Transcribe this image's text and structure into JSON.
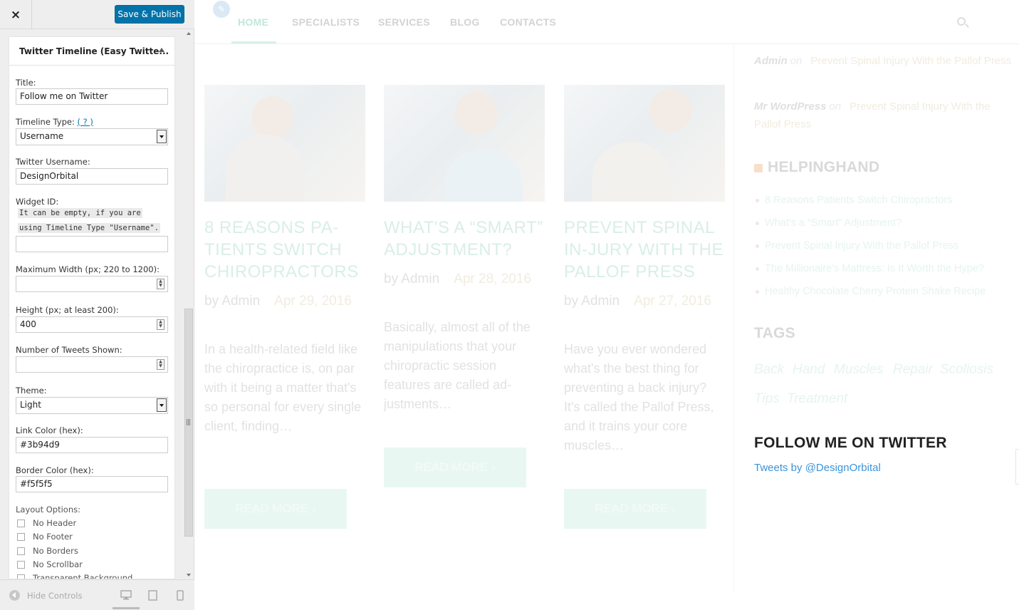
{
  "sidebar": {
    "close_label": "×",
    "save_label": "Save & Publish",
    "panel_title": "Twitter Timeline (Easy Twitte...",
    "fields": {
      "title_label": "Title:",
      "title_value": "Follow me on Twitter",
      "timeline_type_label": "Timeline Type:",
      "timeline_type_help": "( ? )",
      "timeline_type_value": "Username",
      "username_label": "Twitter Username:",
      "username_value": "DesignOrbital",
      "widget_id_label": "Widget ID:",
      "widget_id_desc_1": "It can be empty, if you are",
      "widget_id_desc_2": "using Timeline Type \"Username\".",
      "widget_id_value": "",
      "max_width_label": "Maximum Width (px; 220 to 1200):",
      "max_width_value": "",
      "height_label": "Height (px; at least 200):",
      "height_value": "400",
      "tweets_label": "Number of Tweets Shown:",
      "tweets_value": "",
      "theme_label": "Theme:",
      "theme_value": "Light",
      "link_color_label": "Link Color (hex):",
      "link_color_value": "#3b94d9",
      "border_color_label": "Border Color (hex):",
      "border_color_value": "#f5f5f5",
      "layout_label": "Layout Options:"
    },
    "layout_options": [
      "No Header",
      "No Footer",
      "No Borders",
      "No Scrollbar",
      "Transparent Background"
    ],
    "footer": {
      "hide_controls": "Hide Controls"
    }
  },
  "site": {
    "nav": [
      "HOME",
      "SPECIALISTS",
      "SERVICES",
      "BLOG",
      "CONTACTS"
    ],
    "posts": [
      {
        "title": "8 REASONS PA-TIENTS SWITCH CHIROPRACTORS",
        "author": "by Admin",
        "date": "Apr 29, 2016",
        "excerpt": "In a health-related field like the chiropractice is, on par with it being a matter that's so personal for every single client, finding…",
        "button": "READ MORE"
      },
      {
        "title": "WHAT'S A “SMART” ADJUSTMENT?",
        "author": "by Admin",
        "date": "Apr 28, 2016",
        "excerpt": "Basically, almost all of the manipulations that your chiropractic session features are called ad-justments…",
        "button": "READ MORE"
      },
      {
        "title": "PREVENT SPINAL IN-JURY WITH THE PALLOF PRESS",
        "author": "by Admin",
        "date": "Apr 27, 2016",
        "excerpt": "Have you ever wondered what's the best thing for preventing a back injury? It's called the Pallof Press, and it trains your core muscles…",
        "button": "READ MORE"
      }
    ],
    "comments": [
      {
        "author": "Admin",
        "on": "on",
        "post": "Prevent Spinal Injury With the Pallof Press"
      },
      {
        "author": "Mr WordPress",
        "on": "on",
        "post": "Prevent Spinal Injury With the Pallof Press"
      }
    ],
    "helpinghand_title": "HELPINGHAND",
    "helpinghand_items": [
      "8 Reasons Patients Switch Chiropractors",
      "What's a “Smart” Adjustment?",
      "Prevent Spinal Injury With the Pallof Press",
      "The Millionaire's Mattress: Is It Worth the Hype?",
      "Healthy Chocolate Cherry Protein Shake Recipe"
    ],
    "tags_title": "TAGS",
    "tags": [
      "Back",
      "Hand",
      "Muscles",
      "Repair",
      "Scoliosis",
      "Tips",
      "Treatment"
    ],
    "follow_title": "FOLLOW ME ON TWITTER",
    "tweets_link": "Tweets by @DesignOrbital"
  },
  "colors": {
    "accent": "#0073aa",
    "link": "#3b94d9",
    "brand_faded": "#bfe7dd"
  }
}
